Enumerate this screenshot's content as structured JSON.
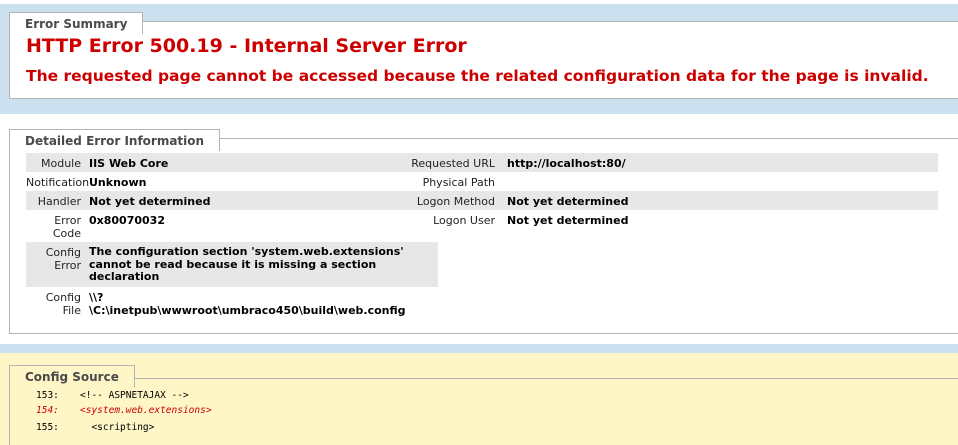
{
  "error_summary": {
    "legend": "Error Summary",
    "title": "HTTP Error 500.19 - Internal Server Error",
    "subtitle": "The requested page cannot be accessed because the related configuration data for the page is invalid."
  },
  "detailed": {
    "legend": "Detailed Error Information",
    "left": [
      {
        "label": "Module",
        "value": "IIS Web Core"
      },
      {
        "label": "Notification",
        "value": "Unknown"
      },
      {
        "label": "Handler",
        "value": "Not yet determined"
      },
      {
        "label_lines": [
          "Error",
          "Code"
        ],
        "value": "0x80070032"
      },
      {
        "label_lines": [
          "Config",
          "Error"
        ],
        "value_lines": [
          "The configuration section 'system.web.extensions'",
          "cannot be read because it is missing a section",
          "declaration"
        ]
      },
      {
        "label_lines": [
          "Config",
          "File"
        ],
        "value_lines": [
          "\\\\?",
          "\\C:\\inetpub\\wwwroot\\umbraco450\\build\\web.config"
        ]
      }
    ],
    "right": [
      {
        "label": "Requested URL",
        "value": "http://localhost:80/"
      },
      {
        "label": "Physical Path",
        "value": ""
      },
      {
        "label": "Logon Method",
        "value": "Not yet determined"
      },
      {
        "label": "Logon User",
        "value": "Not yet determined"
      }
    ]
  },
  "config_source": {
    "legend": "Config Source",
    "lines": [
      {
        "num": "153:",
        "text": "<!-- ASPNETAJAX -->",
        "highlight": false
      },
      {
        "num": "154:",
        "text": "<system.web.extensions>",
        "highlight": true
      },
      {
        "num": "155:",
        "text": "  <scripting>",
        "highlight": false
      }
    ]
  },
  "colors": {
    "error_red": "#cc0000",
    "page_blue": "#cbe1ef",
    "config_yellow": "#fff6c8"
  }
}
